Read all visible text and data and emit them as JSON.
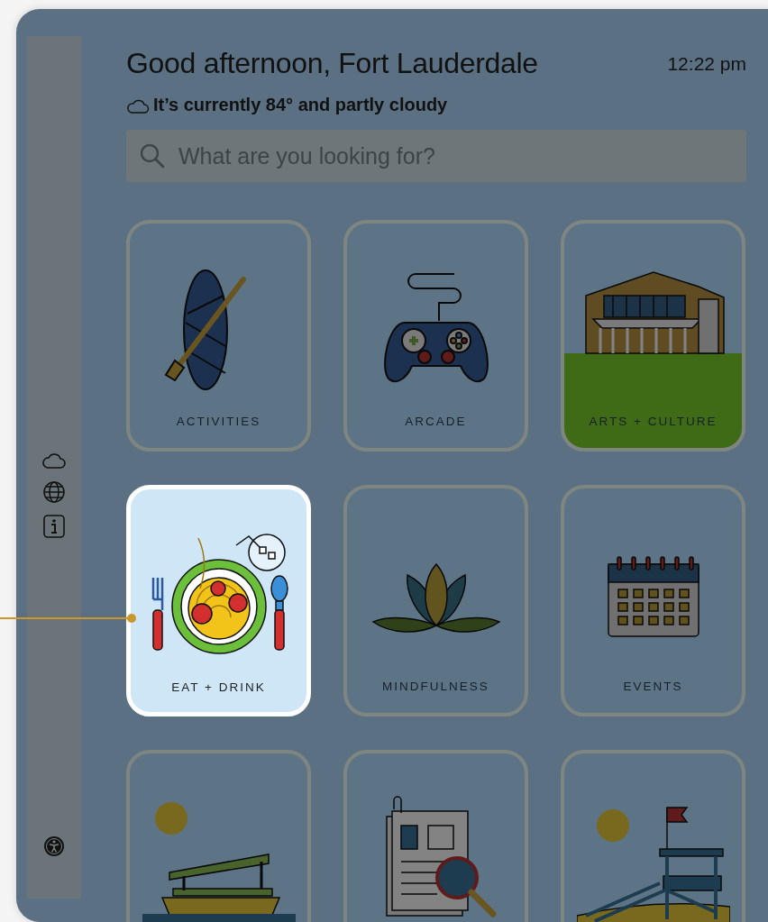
{
  "header": {
    "greeting": "Good afternoon, Fort Lauderdale",
    "time": "12:22 pm",
    "weather": "It’s currently 84° and partly cloudy"
  },
  "search": {
    "placeholder": "What are you looking for?"
  },
  "tiles": [
    {
      "label": "ACTIVITIES",
      "kind": "paddleboard",
      "selected": false
    },
    {
      "label": "ARCADE",
      "kind": "gamepad",
      "selected": false
    },
    {
      "label": "ARTS + CULTURE",
      "kind": "building",
      "selected": false
    },
    {
      "label": "EAT + DRINK",
      "kind": "food",
      "selected": true
    },
    {
      "label": "MINDFULNESS",
      "kind": "lotus",
      "selected": false
    },
    {
      "label": "EVENTS",
      "kind": "calendar",
      "selected": false
    },
    {
      "kind": "boat",
      "selected": false
    },
    {
      "kind": "document",
      "selected": false
    },
    {
      "kind": "lifeguard",
      "selected": false
    }
  ]
}
